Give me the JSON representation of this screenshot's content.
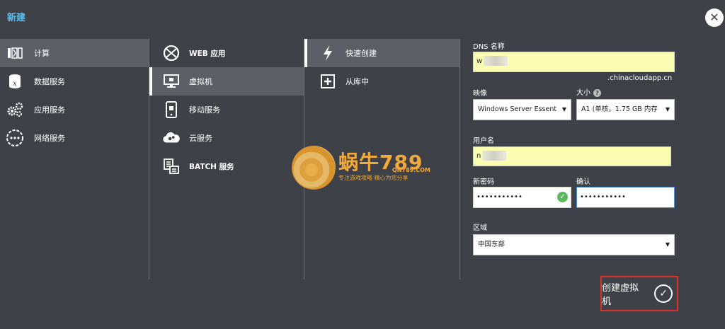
{
  "header": {
    "title": "新建"
  },
  "categories": [
    {
      "label": "计算",
      "icon": "compute-icon"
    },
    {
      "label": "数据服务",
      "icon": "data-services-icon"
    },
    {
      "label": "应用服务",
      "icon": "app-services-icon"
    },
    {
      "label": "网络服务",
      "icon": "network-services-icon"
    }
  ],
  "services": [
    {
      "label": "WEB 应用",
      "icon": "web-app-icon"
    },
    {
      "label": "虚拟机",
      "icon": "virtual-machine-icon"
    },
    {
      "label": "移动服务",
      "icon": "mobile-services-icon"
    },
    {
      "label": "云服务",
      "icon": "cloud-services-icon"
    },
    {
      "label": "BATCH 服务",
      "icon": "batch-services-icon"
    }
  ],
  "methods": [
    {
      "label": "快速创建",
      "icon": "lightning-icon"
    },
    {
      "label": "从库中",
      "icon": "gallery-icon"
    }
  ],
  "form": {
    "dns_label": "DNS 名称",
    "dns_value": "w",
    "dns_suffix": ".chinacloudapp.cn",
    "image_label": "映像",
    "image_value": "Windows Server Essent",
    "size_label": "大小",
    "size_value": "A1 (单核，1.75 GB 内存",
    "user_label": "用户名",
    "user_value": "n",
    "password_label": "新密码",
    "password_value": "•••••••••••",
    "confirm_label": "确认",
    "confirm_value": "•••••••••••",
    "region_label": "区域",
    "region_value": "中国东部"
  },
  "footer": {
    "create_label": "创建虚拟机"
  },
  "watermark": {
    "brand": "蜗牛789",
    "site": "QN789.COM",
    "tagline": "专注游戏攻略   精心为您分享"
  }
}
